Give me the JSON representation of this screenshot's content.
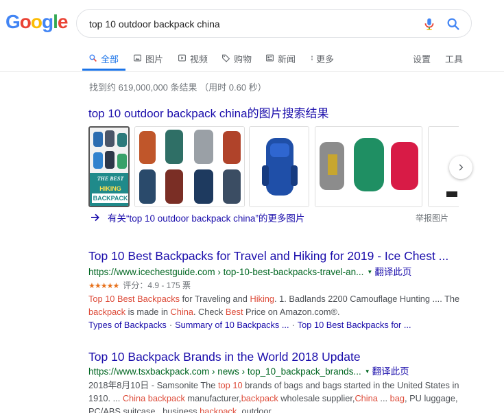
{
  "logo": {
    "letters": [
      "G",
      "o",
      "o",
      "g",
      "l",
      "e"
    ],
    "colors": [
      "#4285F4",
      "#EA4335",
      "#FBBC05",
      "#4285F4",
      "#34A853",
      "#EA4335"
    ]
  },
  "search": {
    "query": "top 10 outdoor backpack china"
  },
  "tabs": [
    {
      "label": "全部",
      "icon": "search-icon",
      "active": true
    },
    {
      "label": "图片",
      "icon": "image-icon"
    },
    {
      "label": "视频",
      "icon": "video-icon"
    },
    {
      "label": "购物",
      "icon": "tag-icon"
    },
    {
      "label": "新闻",
      "icon": "news-icon"
    },
    {
      "label": "更多",
      "icon": "more-vert-icon"
    }
  ],
  "tools": {
    "settings": "设置",
    "tools": "工具"
  },
  "stats": "找到约 619,000,000 条结果 （用时 0.60 秒）",
  "images": {
    "heading_query": "top 10 outdoor backpack china",
    "heading_suffix": "的图片搜索结果",
    "thumb1_text": [
      "THE BEST",
      "HIKING",
      "BACKPACK"
    ],
    "more_link": "有关“top 10 outdoor backpack china”的更多图片",
    "report": "举报图片"
  },
  "results": [
    {
      "title": "Top 10 Best Backpacks for Travel and Hiking for 2019 - Ice Chest ...",
      "url": "https://www.icechestguide.com › top-10-best-backpacks-travel-an...",
      "translate": "翻译此页",
      "stars": "★★★★★",
      "rating": "评分：4.9 - 175 票",
      "snippet_parts": [
        {
          "t": "Top 10 Best Backpacks",
          "hl": true
        },
        {
          "t": " for Traveling and ",
          "hl": false
        },
        {
          "t": "Hiking",
          "hl": true
        },
        {
          "t": ". 1. Badlands 2200 Camouflage Hunting .... The ",
          "hl": false
        },
        {
          "t": "backpack",
          "hl": true
        },
        {
          "t": " is made in ",
          "hl": false
        },
        {
          "t": "China",
          "hl": true
        },
        {
          "t": ". Check ",
          "hl": false
        },
        {
          "t": "Best",
          "hl": true
        },
        {
          "t": " Price on Amazon.com®.",
          "hl": false
        }
      ],
      "sitelinks": [
        "Types of Backpacks",
        "Summary of 10 Backpacks ...",
        "Top 10 Best Backpacks for ..."
      ]
    },
    {
      "title": "Top 10 Backpack Brands in the World 2018 Update",
      "url": "https://www.tsxbackpack.com › news › top_10_backpack_brands...",
      "translate": "翻译此页",
      "snippet_parts": [
        {
          "t": "2018年8月10日 - Samsonite The ",
          "hl": false
        },
        {
          "t": "top 10",
          "hl": true
        },
        {
          "t": " brands of bags and bags started in the United States in 1910. ... ",
          "hl": false
        },
        {
          "t": "China backpack",
          "hl": true
        },
        {
          "t": " manufacturer,",
          "hl": false
        },
        {
          "t": "backpack",
          "hl": true
        },
        {
          "t": " wholesale supplier,",
          "hl": false
        },
        {
          "t": "China",
          "hl": true
        },
        {
          "t": " ... ",
          "hl": false
        },
        {
          "t": "bag",
          "hl": true
        },
        {
          "t": ", PU luggage, PC/ABS suitcase...business ",
          "hl": false
        },
        {
          "t": "backpack",
          "hl": true
        },
        {
          "t": ", outdoor",
          "hl": false
        }
      ]
    }
  ]
}
